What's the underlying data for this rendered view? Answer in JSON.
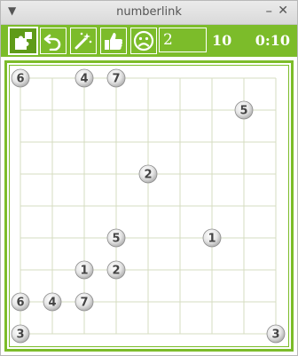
{
  "window": {
    "title": "numberlink"
  },
  "toolbar": {
    "level_value": "2",
    "size_label": "10",
    "timer": "0:10",
    "accent_color": "#7cbc2a",
    "buttons": [
      {
        "name": "puzzle-icon"
      },
      {
        "name": "undo-icon"
      },
      {
        "name": "magic-wand-icon"
      },
      {
        "name": "thumbs-up-icon"
      },
      {
        "name": "sad-face-icon"
      }
    ]
  },
  "board": {
    "rows": 9,
    "cols": 9,
    "grid_color": "#d6dcc0",
    "endpoints": [
      {
        "label": "6",
        "row": 0,
        "col": 0
      },
      {
        "label": "4",
        "row": 0,
        "col": 2
      },
      {
        "label": "7",
        "row": 0,
        "col": 3
      },
      {
        "label": "5",
        "row": 1,
        "col": 7
      },
      {
        "label": "2",
        "row": 3,
        "col": 4
      },
      {
        "label": "5",
        "row": 5,
        "col": 3
      },
      {
        "label": "1",
        "row": 5,
        "col": 6
      },
      {
        "label": "1",
        "row": 6,
        "col": 2
      },
      {
        "label": "2",
        "row": 6,
        "col": 3
      },
      {
        "label": "6",
        "row": 7,
        "col": 0
      },
      {
        "label": "4",
        "row": 7,
        "col": 1
      },
      {
        "label": "7",
        "row": 7,
        "col": 2
      },
      {
        "label": "3",
        "row": 8,
        "col": 0
      },
      {
        "label": "3",
        "row": 8,
        "col": 8
      }
    ]
  }
}
